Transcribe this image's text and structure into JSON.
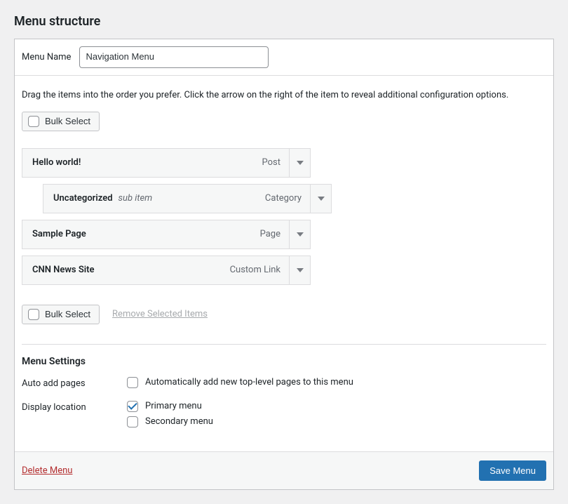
{
  "title": "Menu structure",
  "menuName": {
    "label": "Menu Name",
    "value": "Navigation Menu"
  },
  "helpText": "Drag the items into the order you prefer. Click the arrow on the right of the item to reveal additional configuration options.",
  "bulkSelectLabel": "Bulk Select",
  "removeSelected": "Remove Selected Items",
  "items": [
    {
      "title": "Hello world!",
      "type": "Post",
      "sub": false,
      "subLabel": ""
    },
    {
      "title": "Uncategorized",
      "type": "Category",
      "sub": true,
      "subLabel": "sub item"
    },
    {
      "title": "Sample Page",
      "type": "Page",
      "sub": false,
      "subLabel": ""
    },
    {
      "title": "CNN News Site",
      "type": "Custom Link",
      "sub": false,
      "subLabel": ""
    }
  ],
  "settings": {
    "title": "Menu Settings",
    "autoAdd": {
      "label": "Auto add pages",
      "option": "Automatically add new top-level pages to this menu",
      "checked": false
    },
    "displayLocation": {
      "label": "Display location",
      "options": [
        {
          "label": "Primary menu",
          "checked": true
        },
        {
          "label": "Secondary menu",
          "checked": false
        }
      ]
    }
  },
  "footer": {
    "delete": "Delete Menu",
    "save": "Save Menu"
  }
}
